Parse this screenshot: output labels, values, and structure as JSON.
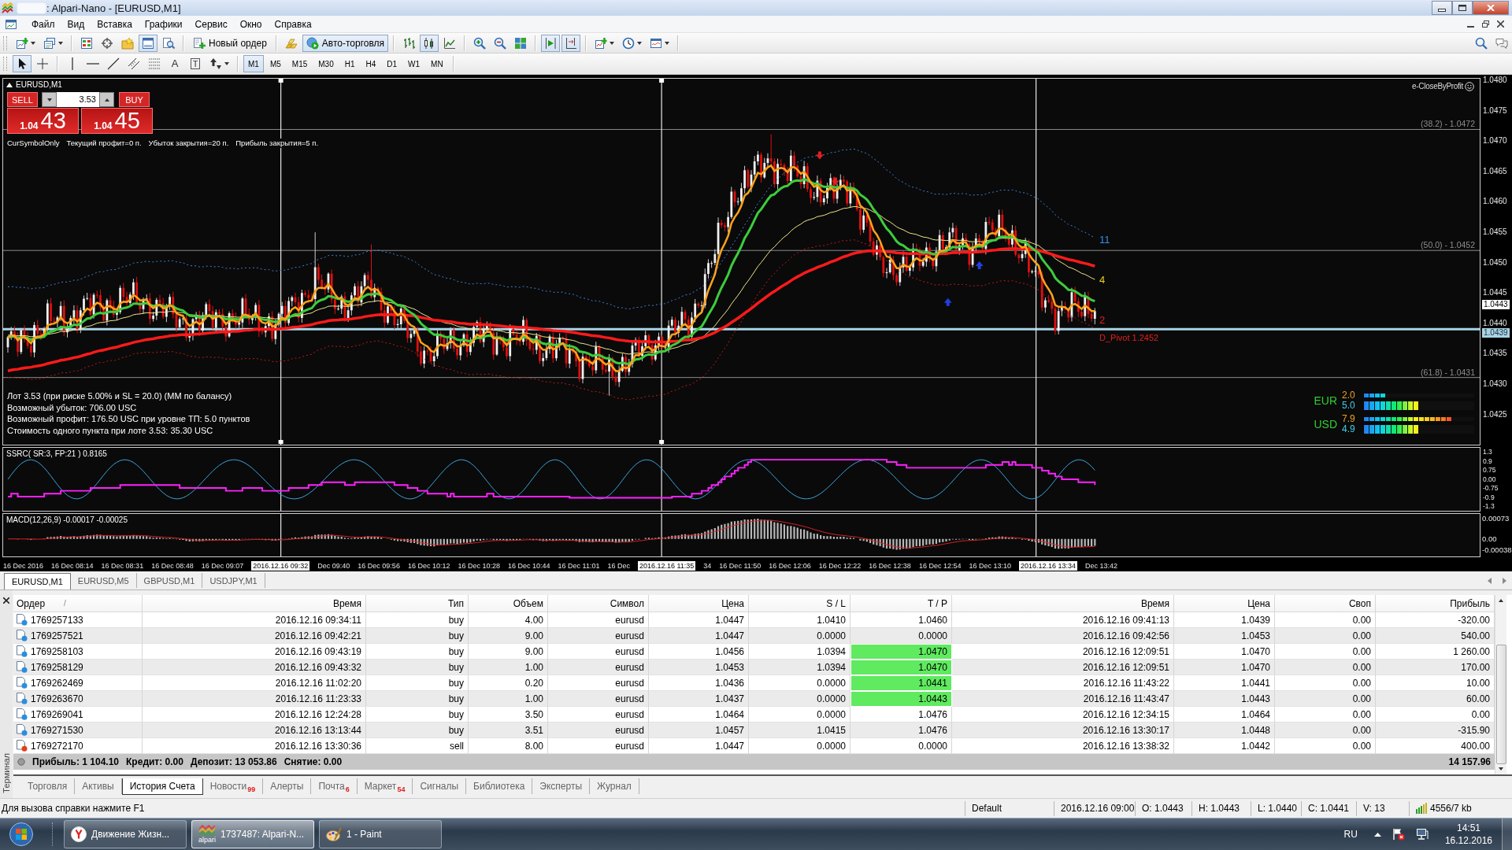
{
  "window": {
    "title": ": Alpari-Nano - [EURUSD,M1]"
  },
  "menu": [
    "Файл",
    "Вид",
    "Вставка",
    "Графики",
    "Сервис",
    "Окно",
    "Справка"
  ],
  "toolbar": {
    "terminal_on": true,
    "new_order": "Новый ордер",
    "auto_trading": {
      "label": "Авто-торговля",
      "on": true
    },
    "chart_types": [
      {
        "selected": false
      },
      {
        "selected": true
      },
      {
        "selected": false
      }
    ],
    "auto_scroll_on": true,
    "chart_shift_on": true
  },
  "drawing_tools": [
    {
      "kind": "cursor",
      "selected": true
    },
    {
      "kind": "crosshair",
      "selected": false
    },
    {
      "kind": "vline",
      "selected": false
    },
    {
      "kind": "hline",
      "selected": false
    },
    {
      "kind": "trendline",
      "selected": false
    },
    {
      "kind": "channel",
      "selected": false
    },
    {
      "kind": "fibo",
      "selected": false
    },
    {
      "kind": "text",
      "glyph": "A",
      "selected": false
    },
    {
      "kind": "label",
      "glyph": "T",
      "selected": false
    },
    {
      "kind": "arrows",
      "selected": false
    }
  ],
  "timeframes": [
    {
      "label": "M1",
      "selected": true
    },
    {
      "label": "M5",
      "selected": false
    },
    {
      "label": "M15",
      "selected": false
    },
    {
      "label": "M30",
      "selected": false
    },
    {
      "label": "H1",
      "selected": false
    },
    {
      "label": "H4",
      "selected": false
    },
    {
      "label": "D1",
      "selected": false
    },
    {
      "label": "W1",
      "selected": false
    },
    {
      "label": "MN",
      "selected": false
    }
  ],
  "chart": {
    "symbol": "EURUSD,M1",
    "one_click": {
      "sell": "SELL",
      "buy": "BUY",
      "lot": "3.53",
      "bid_head": "1.04",
      "bid_tail": "43",
      "ask_head": "1.04",
      "ask_tail": "45"
    },
    "ea_status": [
      "CurSymbolOnly",
      "Текущий профит=0 п.",
      "Убыток закрытия=20 п.",
      "Прибыль закрытия=5 п."
    ],
    "ea_name": "e-CloseByProfit",
    "fib_levels": [
      "(38.2) - 1.0472",
      "(50.0) - 1.0452",
      "(61.8) - 1.0431"
    ],
    "signals": [
      {
        "label": "11",
        "color": "#2f8fe8"
      },
      {
        "label": "4",
        "color": "#e8d020"
      },
      {
        "label": "2",
        "color": "#e02020"
      }
    ],
    "pivot_label": "D_Pivot 1.2452",
    "info_lines": [
      "Лот 3.53 (при риске 5.00% и SL = 20.0) (MM по балансу)",
      "Возможный убыток: 706.00 USC",
      "Возможный профит: 176.50 USC при уровне ТП: 5.0 пунктов",
      "Стоимость одного пункта при лоте 3.53: 35.30 USC"
    ],
    "currency_strength": [
      {
        "currency": "EUR",
        "bars": [
          {
            "value": "2.0",
            "level": 0.2
          },
          {
            "value": "5.0",
            "level": 0.5
          }
        ]
      },
      {
        "currency": "USD",
        "bars": [
          {
            "value": "7.9",
            "level": 0.79
          },
          {
            "value": "4.9",
            "level": 0.49
          }
        ]
      }
    ],
    "price_axis": [
      "1.0480",
      "1.0475",
      "1.0470",
      "1.0465",
      "1.0460",
      "1.0455",
      "1.0450",
      "1.0445",
      "1.0440",
      "1.0435",
      "1.0430",
      "1.0425"
    ],
    "bid_price": "1.0443",
    "line_price": "1.0439",
    "ssrc_label": "SSRC( SR:3, FP:21 ) 0.8165",
    "ssrc_axis": [
      "1.3",
      "0.9",
      "0.75",
      "0.00",
      "-0.75",
      "-0.9",
      "-1.3"
    ],
    "macd_label": "MACD(12,26,9) -0.00017 -0.00025",
    "macd_axis": [
      "0.00073",
      "0.00",
      "-0.00038"
    ],
    "time_axis": [
      {
        "label": "16 Dec 2016",
        "kind": "tick"
      },
      {
        "label": "16 Dec 08:14",
        "kind": "tick"
      },
      {
        "label": "16 Dec 08:31",
        "kind": "tick"
      },
      {
        "label": "16 Dec 08:48",
        "kind": "tick"
      },
      {
        "label": "16 Dec 09:07",
        "kind": "tick"
      },
      {
        "label": "2016.12.16 09:32",
        "kind": "cursor"
      },
      {
        "label": "Dec 09:40",
        "kind": "tick"
      },
      {
        "label": "16 Dec 09:56",
        "kind": "tick"
      },
      {
        "label": "16 Dec 10:12",
        "kind": "tick"
      },
      {
        "label": "16 Dec 10:28",
        "kind": "tick"
      },
      {
        "label": "16 Dec 10:44",
        "kind": "tick"
      },
      {
        "label": "16 Dec 11:01",
        "kind": "tick"
      },
      {
        "label": "16 Dec",
        "kind": "tick"
      },
      {
        "label": "2016.12.16 11:35",
        "kind": "cursor"
      },
      {
        "label": "34",
        "kind": "tick"
      },
      {
        "label": "16 Dec 11:50",
        "kind": "tick"
      },
      {
        "label": "16 Dec 12:06",
        "kind": "tick"
      },
      {
        "label": "16 Dec 12:22",
        "kind": "tick"
      },
      {
        "label": "16 Dec 12:38",
        "kind": "tick"
      },
      {
        "label": "16 Dec 12:54",
        "kind": "tick"
      },
      {
        "label": "16 Dec 13:10",
        "kind": "tick"
      },
      {
        "label": "2016.12.16 13:34",
        "kind": "cursor"
      },
      {
        "label": "Dec 13:42",
        "kind": "tick"
      }
    ]
  },
  "chart_tabs": [
    {
      "label": "EURUSD,M1",
      "selected": true
    },
    {
      "label": "EURUSD,M5",
      "selected": false
    },
    {
      "label": "GBPUSD,M1",
      "selected": false
    },
    {
      "label": "USDJPY,M1",
      "selected": false
    }
  ],
  "terminal": {
    "side_label": "Терминал",
    "sort_mark": "/",
    "columns": [
      "Ордер",
      "Время",
      "Тип",
      "Объем",
      "Символ",
      "Цена",
      "S / L",
      "T / P",
      "Время",
      "Цена",
      "Своп",
      "Прибыль"
    ],
    "rows": [
      {
        "color": "#2a8ee0",
        "tp_hit": false,
        "cells": [
          "1769257133",
          "2016.12.16 09:34:11",
          "buy",
          "4.00",
          "eurusd",
          "1.0447",
          "1.0410",
          "1.0460",
          "2016.12.16 09:41:13",
          "1.0439",
          "0.00",
          "-320.00"
        ]
      },
      {
        "color": "#2a8ee0",
        "tp_hit": false,
        "cells": [
          "1769257521",
          "2016.12.16 09:42:21",
          "buy",
          "9.00",
          "eurusd",
          "1.0447",
          "0.0000",
          "0.0000",
          "2016.12.16 09:42:56",
          "1.0453",
          "0.00",
          "540.00"
        ]
      },
      {
        "color": "#2a8ee0",
        "tp_hit": true,
        "cells": [
          "1769258103",
          "2016.12.16 09:43:19",
          "buy",
          "9.00",
          "eurusd",
          "1.0456",
          "1.0394",
          "1.0470",
          "2016.12.16 12:09:51",
          "1.0470",
          "0.00",
          "1 260.00"
        ]
      },
      {
        "color": "#2a8ee0",
        "tp_hit": true,
        "cells": [
          "1769258129",
          "2016.12.16 09:43:32",
          "buy",
          "1.00",
          "eurusd",
          "1.0453",
          "1.0394",
          "1.0470",
          "2016.12.16 12:09:51",
          "1.0470",
          "0.00",
          "170.00"
        ]
      },
      {
        "color": "#2a8ee0",
        "tp_hit": true,
        "cells": [
          "1769262469",
          "2016.12.16 11:02:20",
          "buy",
          "0.20",
          "eurusd",
          "1.0436",
          "0.0000",
          "1.0441",
          "2016.12.16 11:43:22",
          "1.0441",
          "0.00",
          "10.00"
        ]
      },
      {
        "color": "#2a8ee0",
        "tp_hit": true,
        "cells": [
          "1769263670",
          "2016.12.16 11:23:33",
          "buy",
          "1.00",
          "eurusd",
          "1.0437",
          "0.0000",
          "1.0443",
          "2016.12.16 11:43:47",
          "1.0443",
          "0.00",
          "60.00"
        ]
      },
      {
        "color": "#2a8ee0",
        "tp_hit": false,
        "cells": [
          "1769269041",
          "2016.12.16 12:24:28",
          "buy",
          "3.50",
          "eurusd",
          "1.0464",
          "0.0000",
          "1.0476",
          "2016.12.16 12:34:15",
          "1.0464",
          "0.00",
          "0.00"
        ]
      },
      {
        "color": "#2a8ee0",
        "tp_hit": false,
        "cells": [
          "1769271530",
          "2016.12.16 13:13:44",
          "buy",
          "3.51",
          "eurusd",
          "1.0457",
          "1.0415",
          "1.0476",
          "2016.12.16 13:30:17",
          "1.0448",
          "0.00",
          "-315.90"
        ]
      },
      {
        "color": "#e0401a",
        "tp_hit": false,
        "cells": [
          "1769272170",
          "2016.12.16 13:30:36",
          "sell",
          "8.00",
          "eurusd",
          "1.0447",
          "0.0000",
          "0.0000",
          "2016.12.16 13:38:32",
          "1.0442",
          "0.00",
          "400.00"
        ]
      }
    ],
    "summary": [
      "Прибыль: 1 104.10",
      "Кредит: 0.00",
      "Депозит: 13 053.86",
      "Снятие: 0.00"
    ],
    "total": "14 157.96",
    "tabs": [
      {
        "label": "Торговля",
        "selected": false
      },
      {
        "label": "Активы",
        "selected": false
      },
      {
        "label": "История Счета",
        "selected": true
      },
      {
        "label": "Новости",
        "badge": "99",
        "selected": false
      },
      {
        "label": "Алерты",
        "selected": false
      },
      {
        "label": "Почта",
        "badge": "6",
        "selected": false
      },
      {
        "label": "Маркет",
        "badge": "54",
        "selected": false
      },
      {
        "label": "Сигналы",
        "selected": false
      },
      {
        "label": "Библиотека",
        "selected": false
      },
      {
        "label": "Эксперты",
        "selected": false
      },
      {
        "label": "Журнал",
        "selected": false
      }
    ]
  },
  "status_bar": {
    "hint": "Для вызова справки нажмите F1",
    "profile": "Default",
    "fields": [
      "2016.12.16 09:00",
      "O: 1.0443",
      "H: 1.0443",
      "L: 1.0440",
      "C: 1.0441",
      "V: 13"
    ],
    "traffic": "4556/7 kb"
  },
  "taskbar": {
    "tasks": [
      {
        "kind": "browser",
        "label": "Движение Жизн...",
        "selected": false
      },
      {
        "kind": "alpari",
        "label": "1737487: Alpari-N...",
        "logo_text": "alpari",
        "selected": true
      },
      {
        "kind": "paint",
        "label": "1 - Paint",
        "selected": false
      }
    ],
    "language": "RU",
    "time": "14:51",
    "date": "16.12.2016"
  }
}
